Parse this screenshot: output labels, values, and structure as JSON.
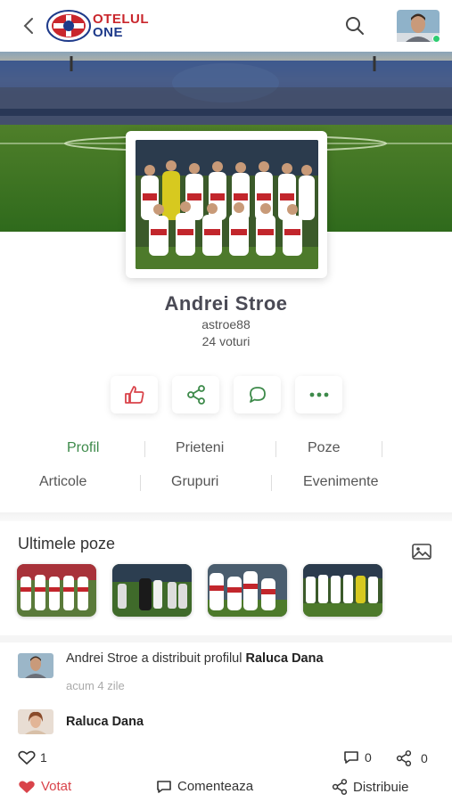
{
  "header": {
    "logo_line1": "OTELUL",
    "logo_line2": "ONE"
  },
  "profile": {
    "name": "Andrei Stroe",
    "username": "astroe88",
    "votes": "24 voturi"
  },
  "tabs": [
    "Profil",
    "Prieteni",
    "Poze",
    "Articole",
    "Grupuri",
    "Evenimente"
  ],
  "photos": {
    "title": "Ultimele poze"
  },
  "feed": {
    "share": {
      "actor": "Andrei Stroe",
      "action": " a distribuit profilul ",
      "target": "Raluca Dana",
      "time": "acum 4 zile"
    },
    "shared_profile_name": "Raluca Dana"
  },
  "stats": {
    "likes": "1",
    "comments": "0",
    "shares": "0"
  },
  "footer": {
    "vote": "Votat",
    "comment": "Comenteaza",
    "share": "Distribuie"
  },
  "colors": {
    "accent_green": "#3d8a4a",
    "like_red": "#d9434a",
    "brand_red": "#c9262c",
    "brand_blue": "#1e3a8a"
  }
}
